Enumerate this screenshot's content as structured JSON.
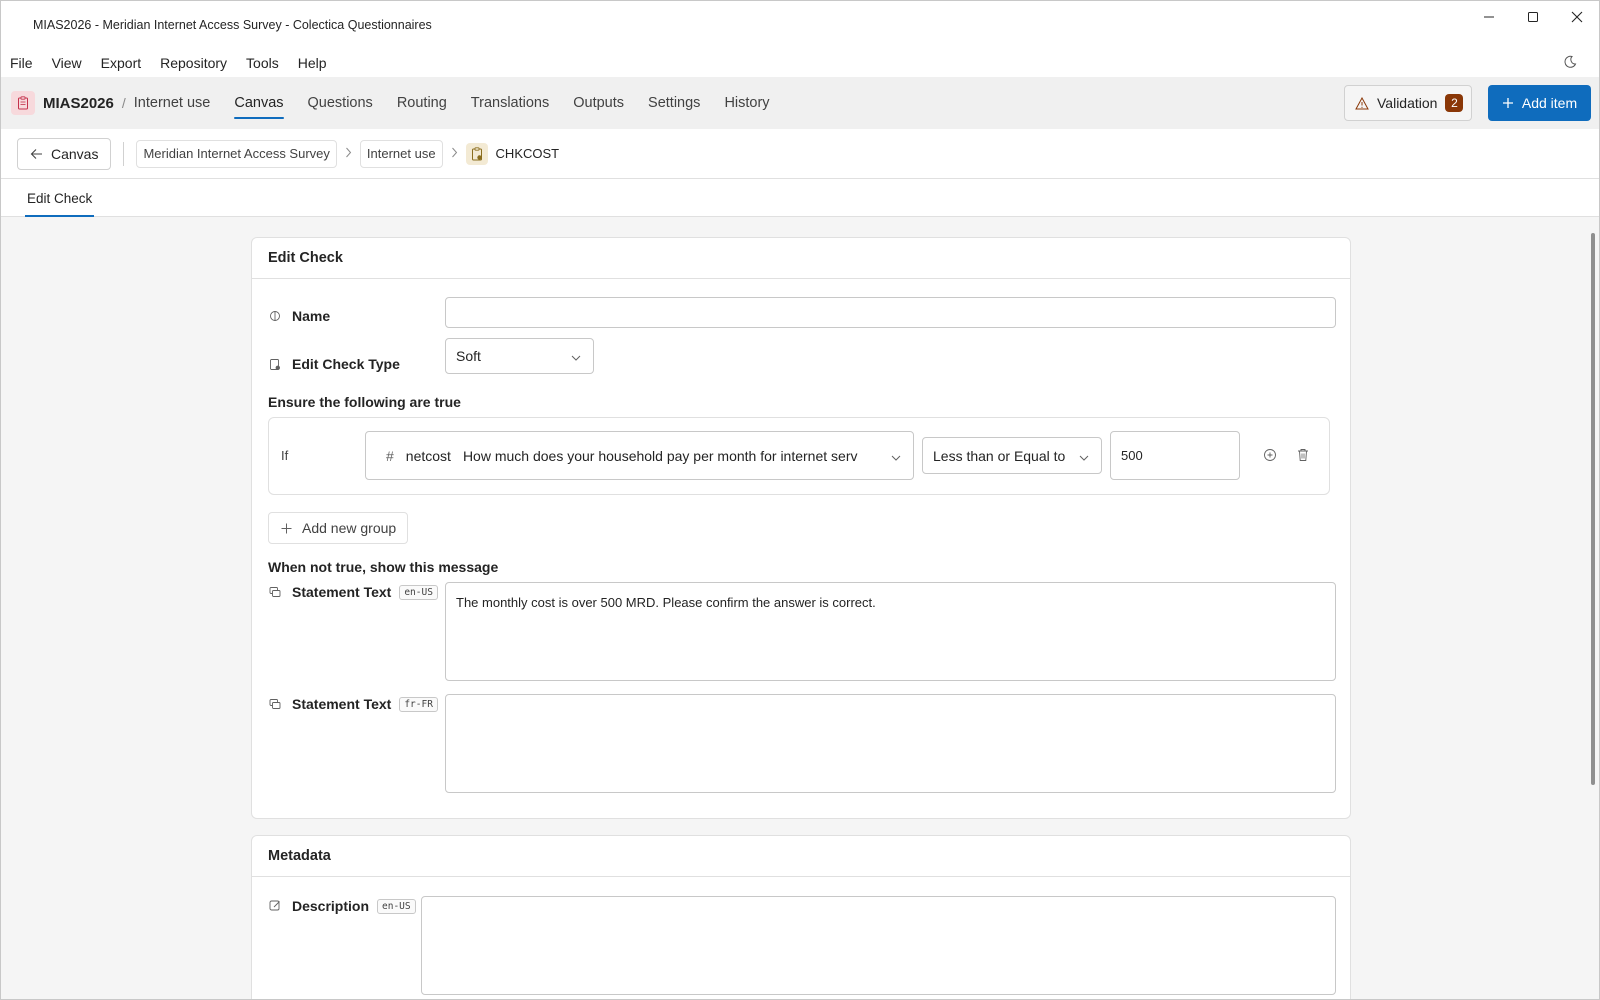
{
  "window": {
    "title": "MIAS2026 - Meridian Internet Access Survey - Colectica Questionnaires"
  },
  "menu": [
    "File",
    "View",
    "Export",
    "Repository",
    "Tools",
    "Help"
  ],
  "appnav": {
    "project": "MIAS2026",
    "separator": "/",
    "section": "Internet use",
    "tabs": [
      "Canvas",
      "Questions",
      "Routing",
      "Translations",
      "Outputs",
      "Settings",
      "History"
    ],
    "active_tab": "Canvas",
    "validation_label": "Validation",
    "validation_count": "2",
    "add_item_label": "Add item"
  },
  "breadcrumb": {
    "back_label": "Canvas",
    "items": [
      "Meridian Internet Access Survey",
      "Internet use"
    ],
    "current": "CHKCOST"
  },
  "subtabs": {
    "active": "Edit Check"
  },
  "edit_check": {
    "header": "Edit Check",
    "name_label": "Name",
    "name_value": "",
    "type_label": "Edit Check Type",
    "type_value": "Soft",
    "ensure_title": "Ensure the following are true",
    "condition": {
      "if_label": "If",
      "variable_symbol": "#",
      "variable_name": "netcost",
      "variable_question": "How much does your household pay per month for internet serv",
      "operator": "Less than or Equal to",
      "value": "500"
    },
    "add_group_label": "Add new group",
    "message_title": "When not true, show this message",
    "statements": [
      {
        "label": "Statement Text",
        "lang": "en-US",
        "text": "The monthly cost is over 500 MRD. Please confirm the answer is correct."
      },
      {
        "label": "Statement Text",
        "lang": "fr-FR",
        "text": ""
      }
    ]
  },
  "metadata": {
    "header": "Metadata",
    "description_label": "Description",
    "description_lang": "en-US",
    "description_value": ""
  },
  "colors": {
    "accent": "#0f6cbd",
    "badge": "#8a3707"
  }
}
